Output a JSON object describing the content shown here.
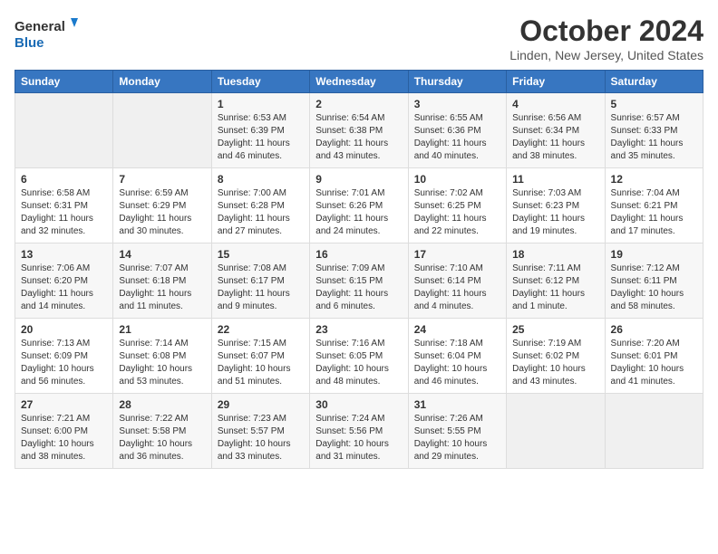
{
  "header": {
    "logo_general": "General",
    "logo_blue": "Blue",
    "month_title": "October 2024",
    "location": "Linden, New Jersey, United States"
  },
  "days_of_week": [
    "Sunday",
    "Monday",
    "Tuesday",
    "Wednesday",
    "Thursday",
    "Friday",
    "Saturday"
  ],
  "weeks": [
    [
      {
        "day": "",
        "info": ""
      },
      {
        "day": "",
        "info": ""
      },
      {
        "day": "1",
        "info": "Sunrise: 6:53 AM\nSunset: 6:39 PM\nDaylight: 11 hours and 46 minutes."
      },
      {
        "day": "2",
        "info": "Sunrise: 6:54 AM\nSunset: 6:38 PM\nDaylight: 11 hours and 43 minutes."
      },
      {
        "day": "3",
        "info": "Sunrise: 6:55 AM\nSunset: 6:36 PM\nDaylight: 11 hours and 40 minutes."
      },
      {
        "day": "4",
        "info": "Sunrise: 6:56 AM\nSunset: 6:34 PM\nDaylight: 11 hours and 38 minutes."
      },
      {
        "day": "5",
        "info": "Sunrise: 6:57 AM\nSunset: 6:33 PM\nDaylight: 11 hours and 35 minutes."
      }
    ],
    [
      {
        "day": "6",
        "info": "Sunrise: 6:58 AM\nSunset: 6:31 PM\nDaylight: 11 hours and 32 minutes."
      },
      {
        "day": "7",
        "info": "Sunrise: 6:59 AM\nSunset: 6:29 PM\nDaylight: 11 hours and 30 minutes."
      },
      {
        "day": "8",
        "info": "Sunrise: 7:00 AM\nSunset: 6:28 PM\nDaylight: 11 hours and 27 minutes."
      },
      {
        "day": "9",
        "info": "Sunrise: 7:01 AM\nSunset: 6:26 PM\nDaylight: 11 hours and 24 minutes."
      },
      {
        "day": "10",
        "info": "Sunrise: 7:02 AM\nSunset: 6:25 PM\nDaylight: 11 hours and 22 minutes."
      },
      {
        "day": "11",
        "info": "Sunrise: 7:03 AM\nSunset: 6:23 PM\nDaylight: 11 hours and 19 minutes."
      },
      {
        "day": "12",
        "info": "Sunrise: 7:04 AM\nSunset: 6:21 PM\nDaylight: 11 hours and 17 minutes."
      }
    ],
    [
      {
        "day": "13",
        "info": "Sunrise: 7:06 AM\nSunset: 6:20 PM\nDaylight: 11 hours and 14 minutes."
      },
      {
        "day": "14",
        "info": "Sunrise: 7:07 AM\nSunset: 6:18 PM\nDaylight: 11 hours and 11 minutes."
      },
      {
        "day": "15",
        "info": "Sunrise: 7:08 AM\nSunset: 6:17 PM\nDaylight: 11 hours and 9 minutes."
      },
      {
        "day": "16",
        "info": "Sunrise: 7:09 AM\nSunset: 6:15 PM\nDaylight: 11 hours and 6 minutes."
      },
      {
        "day": "17",
        "info": "Sunrise: 7:10 AM\nSunset: 6:14 PM\nDaylight: 11 hours and 4 minutes."
      },
      {
        "day": "18",
        "info": "Sunrise: 7:11 AM\nSunset: 6:12 PM\nDaylight: 11 hours and 1 minute."
      },
      {
        "day": "19",
        "info": "Sunrise: 7:12 AM\nSunset: 6:11 PM\nDaylight: 10 hours and 58 minutes."
      }
    ],
    [
      {
        "day": "20",
        "info": "Sunrise: 7:13 AM\nSunset: 6:09 PM\nDaylight: 10 hours and 56 minutes."
      },
      {
        "day": "21",
        "info": "Sunrise: 7:14 AM\nSunset: 6:08 PM\nDaylight: 10 hours and 53 minutes."
      },
      {
        "day": "22",
        "info": "Sunrise: 7:15 AM\nSunset: 6:07 PM\nDaylight: 10 hours and 51 minutes."
      },
      {
        "day": "23",
        "info": "Sunrise: 7:16 AM\nSunset: 6:05 PM\nDaylight: 10 hours and 48 minutes."
      },
      {
        "day": "24",
        "info": "Sunrise: 7:18 AM\nSunset: 6:04 PM\nDaylight: 10 hours and 46 minutes."
      },
      {
        "day": "25",
        "info": "Sunrise: 7:19 AM\nSunset: 6:02 PM\nDaylight: 10 hours and 43 minutes."
      },
      {
        "day": "26",
        "info": "Sunrise: 7:20 AM\nSunset: 6:01 PM\nDaylight: 10 hours and 41 minutes."
      }
    ],
    [
      {
        "day": "27",
        "info": "Sunrise: 7:21 AM\nSunset: 6:00 PM\nDaylight: 10 hours and 38 minutes."
      },
      {
        "day": "28",
        "info": "Sunrise: 7:22 AM\nSunset: 5:58 PM\nDaylight: 10 hours and 36 minutes."
      },
      {
        "day": "29",
        "info": "Sunrise: 7:23 AM\nSunset: 5:57 PM\nDaylight: 10 hours and 33 minutes."
      },
      {
        "day": "30",
        "info": "Sunrise: 7:24 AM\nSunset: 5:56 PM\nDaylight: 10 hours and 31 minutes."
      },
      {
        "day": "31",
        "info": "Sunrise: 7:26 AM\nSunset: 5:55 PM\nDaylight: 10 hours and 29 minutes."
      },
      {
        "day": "",
        "info": ""
      },
      {
        "day": "",
        "info": ""
      }
    ]
  ]
}
